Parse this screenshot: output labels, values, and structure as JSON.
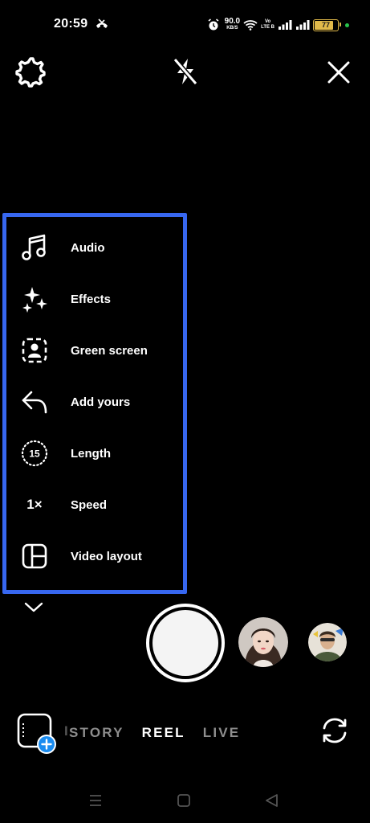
{
  "status_bar": {
    "time": "20:59",
    "net_speed_value": "90.0",
    "net_speed_unit": "KB/S",
    "volte_top": "Vo",
    "volte_bottom": "LTE B",
    "battery_level": "77",
    "icons": [
      "missed-call-icon",
      "alarm-icon",
      "wifi-icon",
      "signal-icon",
      "signal-icon",
      "battery-icon"
    ]
  },
  "top_controls": {
    "settings_icon": "gear-icon",
    "flash_icon": "flash-off-icon",
    "close_icon": "close-icon"
  },
  "tools": [
    {
      "label": "Audio",
      "icon": "music-note-icon"
    },
    {
      "label": "Effects",
      "icon": "sparkles-icon"
    },
    {
      "label": "Green screen",
      "icon": "green-screen-icon"
    },
    {
      "label": "Add yours",
      "icon": "reply-arrow-icon"
    },
    {
      "label": "Length",
      "icon": "timer-icon",
      "icon_text": "15"
    },
    {
      "label": "Speed",
      "icon": "speed-icon",
      "icon_text": "1×"
    },
    {
      "label": "Video layout",
      "icon": "layout-icon"
    }
  ],
  "panel_highlight_color": "#3767f0",
  "bottom": {
    "modes": {
      "faded": "I",
      "story": "STORY",
      "reel": "REEL",
      "live": "LIVE"
    },
    "active_mode": "REEL"
  }
}
